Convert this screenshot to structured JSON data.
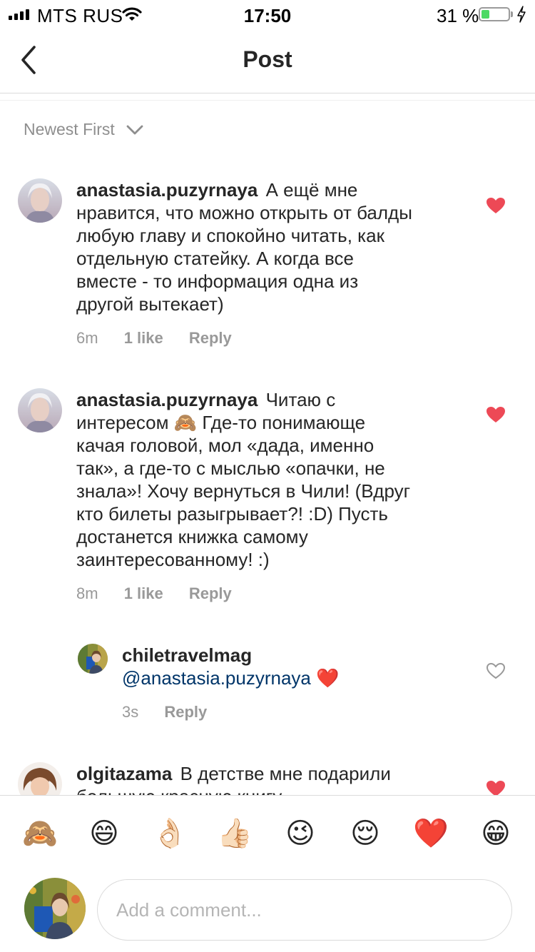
{
  "status_bar": {
    "carrier": "MTS RUS",
    "time": "17:50",
    "battery_percent_label": "31 %",
    "battery_level": 0.31
  },
  "nav": {
    "back_icon": "chevron-left-icon",
    "title": "Post"
  },
  "sort": {
    "label": "Newest First",
    "icon": "chevron-down-icon"
  },
  "comments": [
    {
      "username": "anastasia.puzyrnaya",
      "lines": [
        "А ещё мне",
        "нравится, что можно открыть от балды",
        "любую главу и спокойно читать, как",
        "отдельную статейку. А когда все",
        "вместе - то информация одна из",
        "другой вытекает)"
      ],
      "time": "6m",
      "likes": "1 like",
      "reply_label": "Reply",
      "liked": true
    },
    {
      "username": "anastasia.puzyrnaya",
      "lines": [
        "Читаю с",
        "интересом 🙈 Где-то понимающе",
        "качая головой, мол «дада, именно",
        "так», а где-то с мыслью «опачки, не",
        "знала»! Хочу вернуться в Чили! (Вдруг",
        "кто билеты разыгрывает?! :D) Пусть",
        "достанется книжка самому",
        "заинтересованному! :)"
      ],
      "time": "8m",
      "likes": "1 like",
      "reply_label": "Reply",
      "liked": true
    },
    {
      "username": "olgitazama",
      "lines": [
        "В детстве мне подарили",
        "большую красную книгу"
      ],
      "liked": true
    }
  ],
  "reply": {
    "username": "chiletravelmag",
    "mention": "@anastasia.puzyrnaya",
    "emoji": "❤️",
    "time": "3s",
    "reply_label": "Reply",
    "liked": false
  },
  "emoji_bar": [
    "🙈",
    "😄",
    "👌🏻",
    "👍🏻",
    "😉",
    "😌",
    "❤️",
    "😁"
  ],
  "composer": {
    "placeholder": "Add a comment..."
  },
  "colors": {
    "heart_red": "#ed4956",
    "mention_blue": "#003569",
    "meta_gray": "#999999",
    "border": "#dbdbdb"
  }
}
